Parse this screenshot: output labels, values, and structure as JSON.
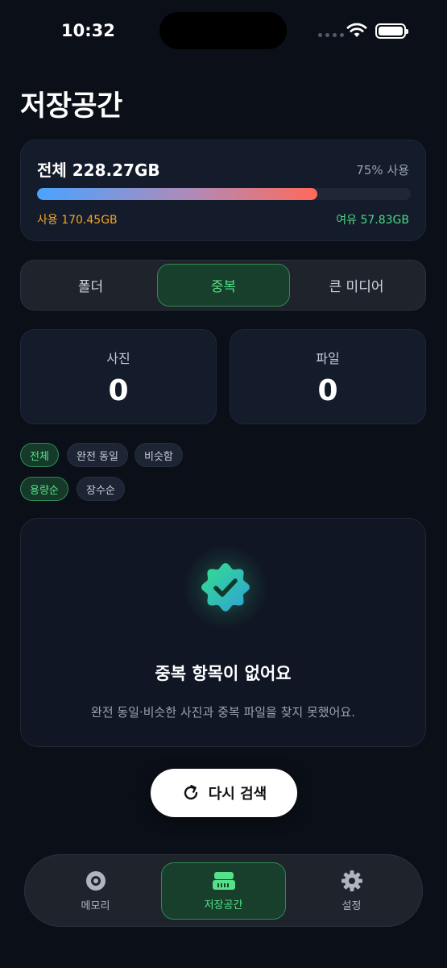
{
  "status_bar": {
    "time": "10:32"
  },
  "page": {
    "title": "저장공간"
  },
  "storage": {
    "total_label": "전체 228.27GB",
    "percent_label": "75% 사용",
    "used_fraction": 0.75,
    "used_label": "사용 170.45GB",
    "free_label": "여유 57.83GB"
  },
  "segments": [
    {
      "label": "폴더",
      "active": false
    },
    {
      "label": "중복",
      "active": true
    },
    {
      "label": "큰 미디어",
      "active": false
    }
  ],
  "stats": [
    {
      "label": "사진",
      "value": "0"
    },
    {
      "label": "파일",
      "value": "0"
    }
  ],
  "filters": {
    "type_chips": [
      {
        "label": "전체",
        "active": true
      },
      {
        "label": "완전 동일",
        "active": false
      },
      {
        "label": "비슷함",
        "active": false
      }
    ],
    "sort_chips": [
      {
        "label": "용량순",
        "active": true
      },
      {
        "label": "장수순",
        "active": false
      }
    ]
  },
  "empty_state": {
    "icon": "verified-check-badge-icon",
    "title": "중복 항목이 없어요",
    "description": "완전 동일·비슷한 사진과 중복 파일을 찾지 못했어요."
  },
  "rescan": {
    "icon": "refresh-icon",
    "label": "다시 검색"
  },
  "tab_bar": [
    {
      "label": "메모리",
      "icon": "memory-disc-icon",
      "active": false
    },
    {
      "label": "저장공간",
      "icon": "storage-drive-icon",
      "active": true
    },
    {
      "label": "설정",
      "icon": "gear-icon",
      "active": false
    }
  ],
  "colors": {
    "background": "#0b0f17",
    "accent_green": "#55e08a",
    "used_orange": "#f5a623",
    "free_green": "#4cd982"
  }
}
